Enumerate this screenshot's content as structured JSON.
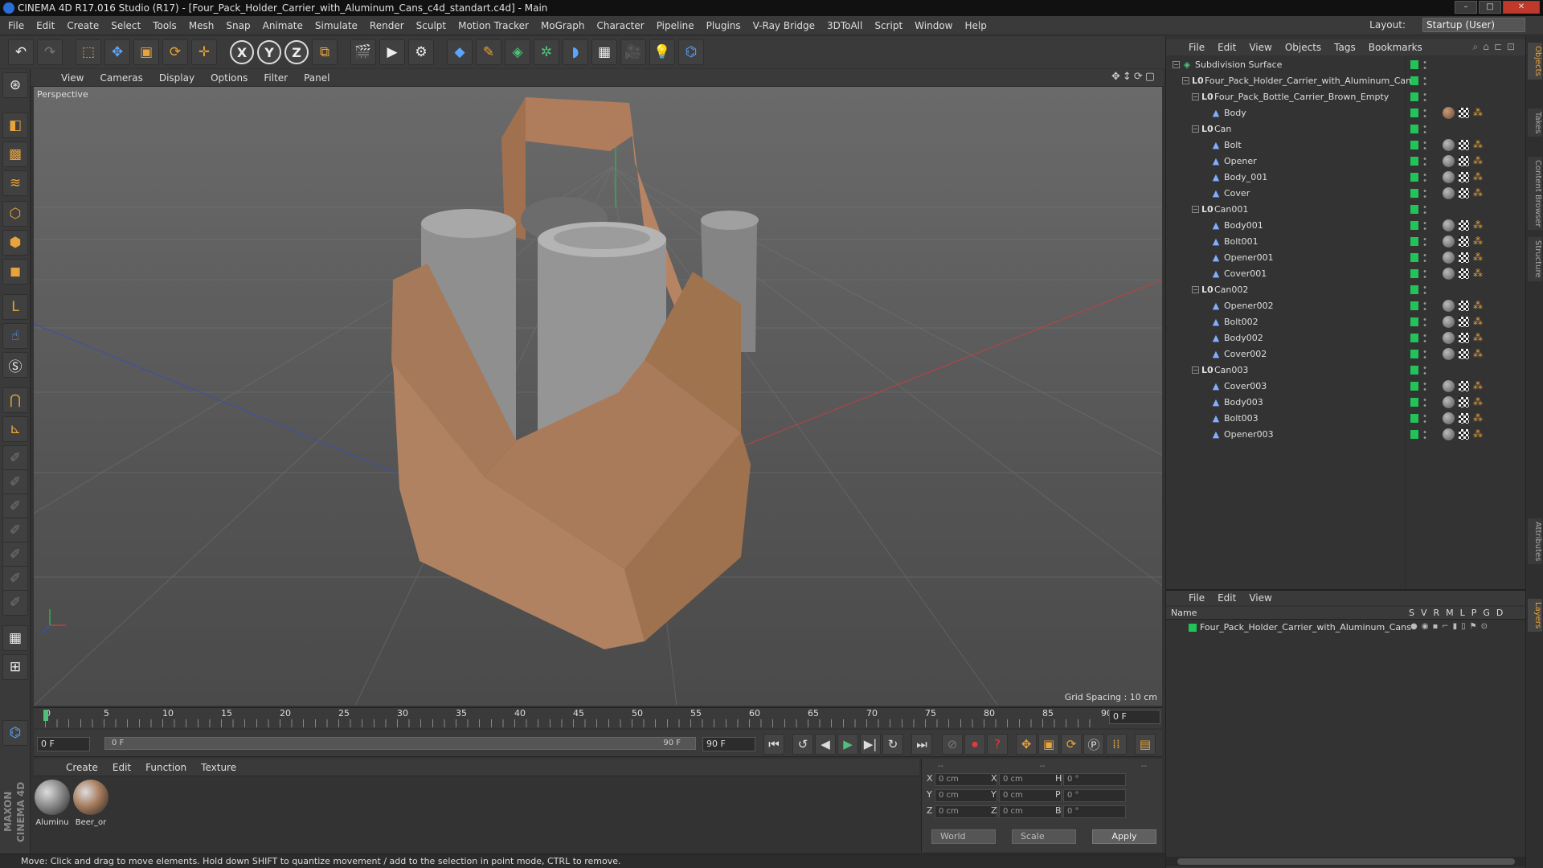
{
  "title": "CINEMA 4D R17.016 Studio (R17) - [Four_Pack_Holder_Carrier_with_Aluminum_Cans_c4d_standart.c4d] - Main",
  "menu": [
    "File",
    "Edit",
    "Create",
    "Select",
    "Tools",
    "Mesh",
    "Snap",
    "Animate",
    "Simulate",
    "Render",
    "Sculpt",
    "Motion Tracker",
    "MoGraph",
    "Character",
    "Pipeline",
    "Plugins",
    "V-Ray Bridge",
    "3DToAll",
    "Script",
    "Window",
    "Help"
  ],
  "layout": {
    "label": "Layout:",
    "value": "Startup (User)"
  },
  "viewport": {
    "menu": [
      "View",
      "Cameras",
      "Display",
      "Options",
      "Filter",
      "Panel"
    ],
    "label": "Perspective",
    "grid_spacing": "Grid Spacing : 10 cm"
  },
  "timeline": {
    "ticks": [
      "0",
      "5",
      "10",
      "15",
      "20",
      "25",
      "30",
      "35",
      "40",
      "45",
      "50",
      "55",
      "60",
      "65",
      "70",
      "75",
      "80",
      "85",
      "90"
    ],
    "current_frame": "0 F",
    "start_field": "0 F",
    "range_start": "0 F",
    "range_end": "90 F",
    "end_field": "90 F"
  },
  "materials": {
    "menu": [
      "Create",
      "Edit",
      "Function",
      "Texture"
    ],
    "items": [
      {
        "label": "Aluminu",
        "color": "#8a8a8a"
      },
      {
        "label": "Beer_or",
        "color": "#a57b5c"
      }
    ]
  },
  "coords": {
    "header": [
      "--",
      "--",
      "--"
    ],
    "rows": [
      {
        "a": "X",
        "av": "0 cm",
        "b": "X",
        "bv": "0 cm",
        "c": "H",
        "cv": "0 °"
      },
      {
        "a": "Y",
        "av": "0 cm",
        "b": "Y",
        "bv": "0 cm",
        "c": "P",
        "cv": "0 °"
      },
      {
        "a": "Z",
        "av": "0 cm",
        "b": "Z",
        "bv": "0 cm",
        "c": "B",
        "cv": "0 °"
      }
    ],
    "world": "World",
    "scale": "Scale",
    "apply": "Apply"
  },
  "status": "Move: Click and drag to move elements. Hold down SHIFT to quantize movement / add to the selection in point mode, CTRL to remove.",
  "objects_menu": [
    "File",
    "Edit",
    "View",
    "Objects",
    "Tags",
    "Bookmarks"
  ],
  "objects": [
    {
      "name": "Subdivision Surface",
      "type": "sub"
    },
    {
      "name": "Four_Pack_Holder_Carrier_with_Aluminum_Cans",
      "type": "null"
    },
    {
      "name": "Four_Pack_Bottle_Carrier_Brown_Empty",
      "type": "null"
    },
    {
      "name": "Body",
      "type": "mesh",
      "mat": "brown"
    },
    {
      "name": "Can",
      "type": "null"
    },
    {
      "name": "Bolt",
      "type": "mesh",
      "mat": "grey"
    },
    {
      "name": "Opener",
      "type": "mesh",
      "mat": "grey"
    },
    {
      "name": "Body_001",
      "type": "mesh",
      "mat": "grey"
    },
    {
      "name": "Cover",
      "type": "mesh",
      "mat": "grey"
    },
    {
      "name": "Can001",
      "type": "null"
    },
    {
      "name": "Body001",
      "type": "mesh",
      "mat": "grey"
    },
    {
      "name": "Bolt001",
      "type": "mesh",
      "mat": "grey"
    },
    {
      "name": "Opener001",
      "type": "mesh",
      "mat": "grey"
    },
    {
      "name": "Cover001",
      "type": "mesh",
      "mat": "grey"
    },
    {
      "name": "Can002",
      "type": "null"
    },
    {
      "name": "Opener002",
      "type": "mesh",
      "mat": "grey"
    },
    {
      "name": "Bolt002",
      "type": "mesh",
      "mat": "grey"
    },
    {
      "name": "Body002",
      "type": "mesh",
      "mat": "grey"
    },
    {
      "name": "Cover002",
      "type": "mesh",
      "mat": "grey"
    },
    {
      "name": "Can003",
      "type": "null"
    },
    {
      "name": "Cover003",
      "type": "mesh",
      "mat": "grey"
    },
    {
      "name": "Body003",
      "type": "mesh",
      "mat": "grey"
    },
    {
      "name": "Bolt003",
      "type": "mesh",
      "mat": "grey"
    },
    {
      "name": "Opener003",
      "type": "mesh",
      "mat": "grey"
    }
  ],
  "layers_menu": [
    "File",
    "Edit",
    "View"
  ],
  "layers_header": {
    "name": "Name",
    "cols": "SVRMLPGD"
  },
  "layers": [
    {
      "name": "Four_Pack_Holder_Carrier_with_Aluminum_Cans",
      "color": "#22c45a"
    }
  ],
  "side_tabs": [
    "Objects",
    "Takes",
    "Content Browser",
    "Structure",
    "Attributes",
    "Layers"
  ],
  "maxon_logo": "MAXON CINEMA 4D"
}
